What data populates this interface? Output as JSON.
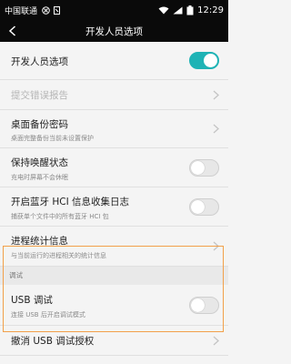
{
  "statusbar": {
    "carrier": "中国联通",
    "time": "12:29",
    "icons": [
      "sim-icon",
      "data-icon",
      "wifi-icon",
      "signal-icon",
      "battery-icon"
    ]
  },
  "header": {
    "title": "开发人员选项",
    "back_icon": "back-arrow-icon"
  },
  "items": [
    {
      "title": "开发人员选项",
      "control": "switch",
      "checked": true
    },
    {
      "title": "提交错误报告",
      "control": "chevron",
      "disabled": true
    },
    {
      "title": "桌面备份密码",
      "subtitle": "桌面完整备份当前未设置保护",
      "control": "chevron"
    },
    {
      "title": "保持唤醒状态",
      "subtitle": "充电时屏幕不会休眠",
      "control": "switch",
      "checked": false
    },
    {
      "title": "开启蓝牙 HCI 信息收集日志",
      "subtitle": "捕获单个文件中的所有蓝牙 HCI 包",
      "control": "switch",
      "checked": false
    },
    {
      "title": "进程统计信息",
      "subtitle": "与当前运行的进程相关的统计信息",
      "control": "chevron"
    }
  ],
  "debug_section": {
    "header": "调试",
    "usb_debugging": {
      "title": "USB 调试",
      "subtitle": "连接 USB 后开启调试模式",
      "checked": false
    },
    "revoke": {
      "title": "撤消 USB 调试授权"
    }
  },
  "colors": {
    "accent": "#1fb3b5",
    "highlight": "#f2a04a",
    "statusbar": "#0a0a0a",
    "background": "#f4f4f4"
  }
}
